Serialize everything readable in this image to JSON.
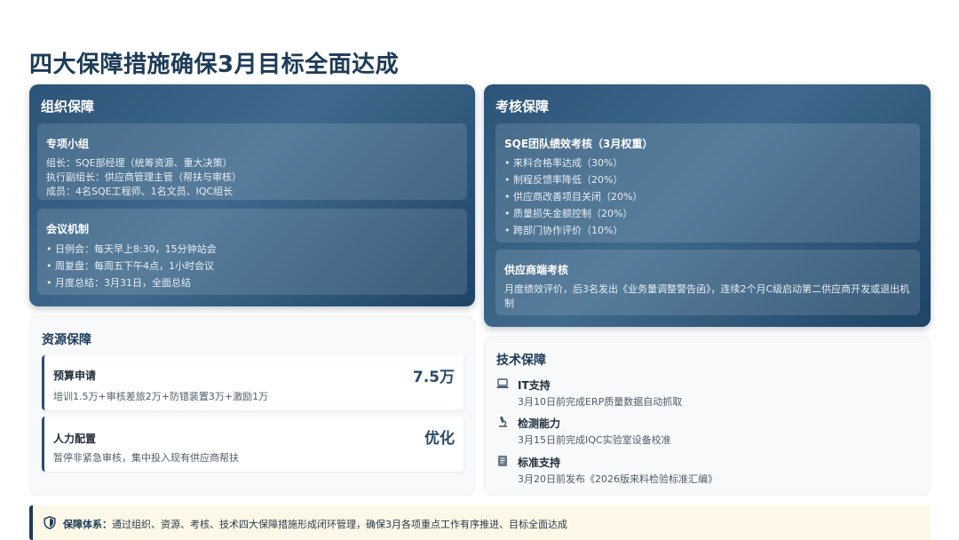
{
  "page": {
    "title": "四大保障措施确保3月目标全面达成"
  },
  "org": {
    "title": "组织保障",
    "team": {
      "title": "专项小组",
      "lines": [
        "组长：SQE部经理（统筹资源、重大决策）",
        "执行副组长：供应商管理主管（帮扶与审核）",
        "成员：4名SQE工程师、1名文员、IQC组长"
      ]
    },
    "meeting": {
      "title": "会议机制",
      "lines": [
        "• 日例会：每天早上8:30，15分钟站会",
        "• 周复盘：每周五下午4点，1小时会议",
        "• 月度总结：3月31日，全面总结"
      ]
    }
  },
  "assess": {
    "title": "考核保障",
    "sqe": {
      "title": "SQE团队绩效考核（3月权重）",
      "lines": [
        "• 来料合格率达成（30%）",
        "• 制程反馈率降低（20%）",
        "• 供应商改善项目关闭（20%）",
        "• 质量损失金额控制（20%）",
        "• 跨部门协作评价（10%）"
      ]
    },
    "supplier": {
      "title": "供应商端考核",
      "lines": [
        "月度绩效评价，后3名发出《业务量调整警告函》，连续2个月C级启动第二供应商开发或退出机",
        "制"
      ]
    }
  },
  "resource": {
    "title": "资源保障",
    "budget": {
      "title": "预算申请",
      "value": "7.5万",
      "desc": "培训1.5万+审核差旅2万+防错装置3万+激励1万"
    },
    "staff": {
      "title": "人力配置",
      "value": "优化",
      "desc": "暂停非紧急审核，集中投入现有供应商帮扶"
    }
  },
  "tech": {
    "title": "技术保障",
    "items": [
      {
        "icon": "laptop-icon",
        "title": "IT支持",
        "desc": "3月10日前完成ERP质量数据自动抓取"
      },
      {
        "icon": "microscope-icon",
        "title": "检测能力",
        "desc": "3月15日前完成IQC实验室设备校准"
      },
      {
        "icon": "book-icon",
        "title": "标准支持",
        "desc": "3月20日前发布《2026版来料检验标准汇编》"
      }
    ]
  },
  "summary": {
    "label": "保障体系：",
    "text": "通过组织、资源、考核、技术四大保障措施形成闭环管理，确保3月各项重点工作有序推进、目标全面达成"
  },
  "colors": {
    "primary": "#1d3b58",
    "card_dark": "#2c5478",
    "bar_bg": "#fdf8e8"
  }
}
